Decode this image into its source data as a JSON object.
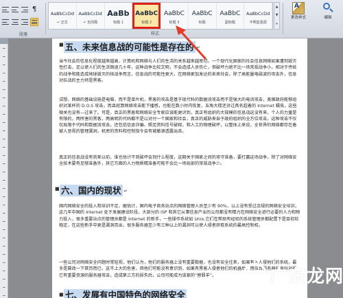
{
  "ribbon": {
    "paragraph_group_label": "段落",
    "styles_group_label": "样式",
    "styles": [
      {
        "sample": "AaBbCcDd",
        "name": "↵ 正文",
        "weight": "normal",
        "size": 6.5
      },
      {
        "sample": "AaBbCcDd",
        "name": "↵ 无间隔",
        "weight": "normal",
        "size": 6.5
      },
      {
        "sample": "AaBb",
        "name": "标题 1",
        "weight": "bold",
        "size": 11
      },
      {
        "sample": "AaBbC",
        "name": "标题 2",
        "weight": "bold",
        "size": 9
      },
      {
        "sample": "AaBbC",
        "name": "标题 3",
        "weight": "normal",
        "size": 9
      },
      {
        "sample": "AaBbC",
        "name": "标题",
        "weight": "normal",
        "size": 9
      },
      {
        "sample": "AaBbC",
        "name": "副标题",
        "weight": "normal",
        "size": 9
      },
      {
        "sample": "AaBbCcDd",
        "name": "不明显强调",
        "weight": "normal",
        "size": 6.5
      }
    ],
    "selected_style_index": 3,
    "change_styles_label": "更改样式",
    "editing_label": "编辑"
  },
  "document": {
    "heading5": "五、未来信息战的可能性是存在的",
    "heading6": "六、国内的现状",
    "heading7": "七、发展有中国特色的网络安全",
    "para1": "当今社会的信息化程度越来越高，计算机和网络与人们的生活的关系越来越密切。一个现代化国家的社会信息网络如果遭到毁灭性打击，足以使人们的生活倒退几十年，这种战争比较文明，不会造成人员伤亡，但破坏力绝不比一场常规战争小。相对于传统的战争和能造成地球毁灭的核战争而言，信息战的可能性更大，在网络更加发达的未来社会，除了高能量电磁波的攻击外，信息对抗战的主力将是黑客。",
    "para2": "试想，网络的基础设施是电脑，而不是单片机，黑客的攻击是基于现代科的数据流攻击而不是强大的电流攻击，美国政府能够组织对某杆的 D.O.S 攻击，而且就算网络攻击能下播感，也能在数小时内恢复，五角大楼还对过具名超着的 Internet 蠕虫，这些微关也没有—过来了。可是，真正的黑客和网络安全专家应该能更识到，真正有组织的大规模的信息战这没有来，个人的力量是有限的，两所害的黑客，两高明的代码都不是以对付一个国家和社会，真正的威胁来自于政府组织的全方位攻击，这种攻击不仅仅局限于代码和数据流攻击，还包括信息诈骗、照足资料信号破释，和人工的物理破坏，以整体上来说，全世界的网络都存在着被人恶视的管理漏洞，机密的资料和控制指令会有被撤滴透露出去。",
    "para3": "真正的信息战没有到来以前，谁也估计不到破坏会到什么程度，这期关于国家之间的攻守准备，要打赢这场战争，除了对网络安全技术要有足够准备外，其它方面的人力物质精准备可能不会比一场局部的常规战争少。",
    "para4": "国内网络安全的投入和培训不足，据估计，国内电子商务站点的网络管理人员至少有 90%，以上没有受过正规的网络安全培训，这几年中国的 Internet 处于发展建设阶段，大部分的 ISP 和其它从事信息产业的公司都没有精力在网络安全进行必要的人力和物力投入，很多重要站点的管理员都是 Internet 的新手，一些操作系统如 Unix,它们在帮助有经验的系统管理员都配置下是目前较稳定，在这些新手中更是漏洞百出，很多服务器至少有三种以上的漏洞可以使人侵者获取系统的最高控制权。",
    "para5": "一些公司对网络安全问题时常轻视，他们认为，他们的服务器上没有重要数据，也没有安全往来，如果有入人侵他们的系统，最多是篡改一下首页而已，这不上大的危害，但他们可能没有意识到，如果有黑客人侵者他们的机器后，用伍台服务器的身份对其它有重要资源的服务器攻击，造成第三方的损失后，公司可能成为该案的“替罪羊”。"
  }
}
